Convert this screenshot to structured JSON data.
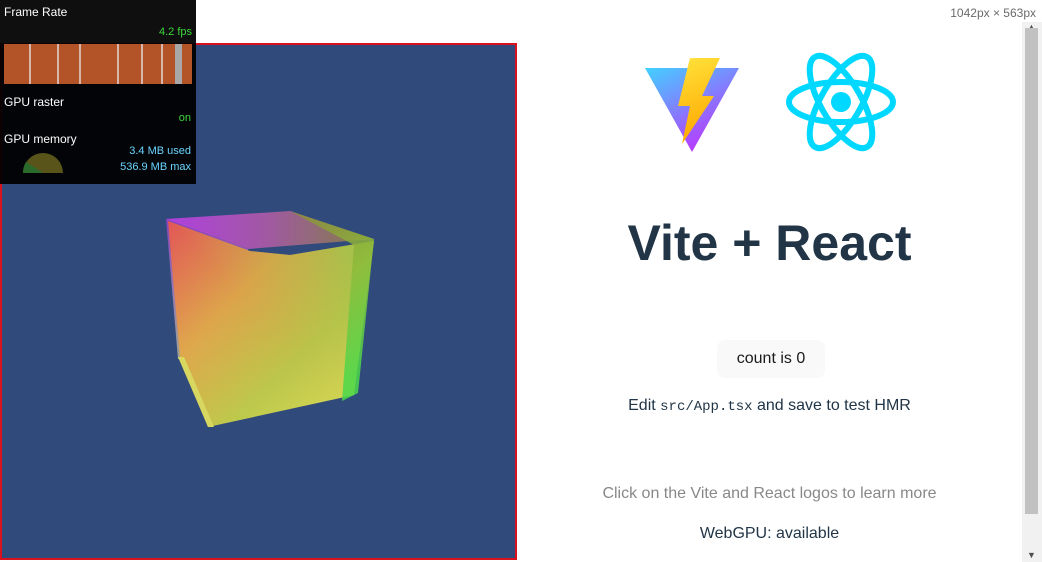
{
  "viewport": {
    "dimensions_label": "1042px × 563px"
  },
  "rendering_overlay": {
    "frame_rate_label": "Frame Rate",
    "fps_value": "4.2 fps",
    "gpu_raster_label": "GPU raster",
    "gpu_raster_value": "on",
    "gpu_memory_label": "GPU memory",
    "gpu_memory_used": "3.4 MB used",
    "gpu_memory_max": "536.9 MB max"
  },
  "app": {
    "title": "Vite + React",
    "count_button_label": "count is 0",
    "edit_prefix": "Edit ",
    "edit_code": "src/App.tsx",
    "edit_suffix": " and save to test HMR",
    "read_docs": "Click on the Vite and React logos to learn more",
    "webgpu_status": "WebGPU: available"
  },
  "colors": {
    "canvas_background": "#314a7c",
    "canvas_border": "#d9121f",
    "title_text": "#213547",
    "react_blue": "#00d8ff",
    "fps_green": "#39d739"
  },
  "icons": [
    "vite-logo-icon",
    "react-logo-icon",
    "scroll-up-arrow-icon",
    "scroll-down-arrow-icon"
  ]
}
